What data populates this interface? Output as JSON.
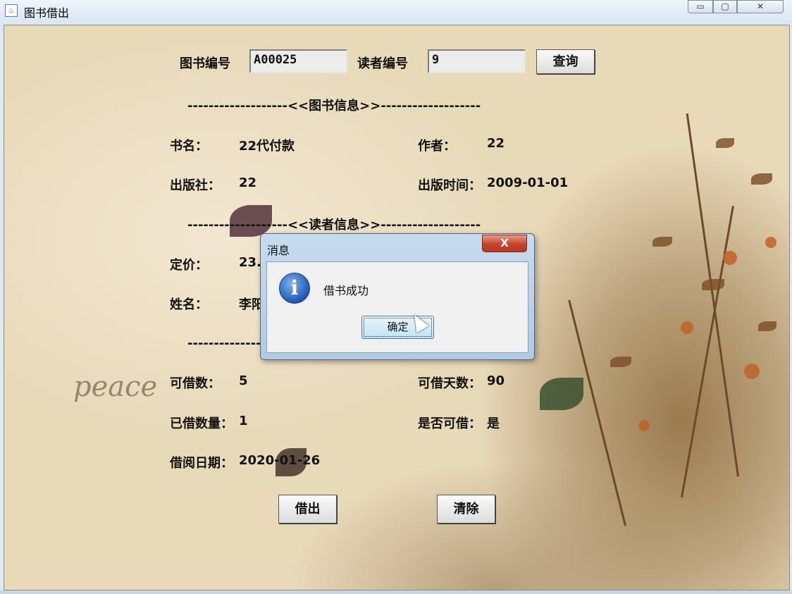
{
  "window": {
    "title": "图书借出",
    "icon": "java-app-icon",
    "controls": [
      "minimize-icon",
      "maximize-icon",
      "close-icon"
    ]
  },
  "search": {
    "book_no_label": "图书编号",
    "book_no_value": "A00025",
    "reader_no_label": "读者编号",
    "reader_no_value": "9",
    "query_button": "查询"
  },
  "separators": {
    "book_info": "-------------------<<图书信息>>-------------------",
    "reader_info": "-------------------<<读者信息>>-------------------",
    "third": "-------------------<<读者信息>>-------------------"
  },
  "book": {
    "name_label": "书名：",
    "name_value": "22代付款",
    "author_label": "作者：",
    "author_value": "22",
    "publisher_label": "出版社：",
    "publisher_value": "22",
    "pubdate_label": "出版时间：",
    "pubdate_value": "2009-01-01",
    "price_label": "定价：",
    "price_value": "23.",
    "reader_name_label": "姓名：",
    "reader_name_value": "李阳"
  },
  "borrow": {
    "can_borrow_count_label": "可借数：",
    "can_borrow_count_value": "5",
    "borrow_days_label": "可借天数：",
    "borrow_days_value": "90",
    "borrowed_count_label": "已借数量：",
    "borrowed_count_value": "1",
    "can_borrow_label": "是否可借：",
    "can_borrow_value": "是",
    "borrow_date_label": "借阅日期：",
    "borrow_date_value": "2020-01-26"
  },
  "actions": {
    "lend_button": "借出",
    "clear_button": "清除"
  },
  "dialog": {
    "title": "消息",
    "close": "X",
    "icon": "info-icon",
    "message": "借书成功",
    "ok_button": "确定"
  },
  "background": {
    "watermark": "peace"
  }
}
